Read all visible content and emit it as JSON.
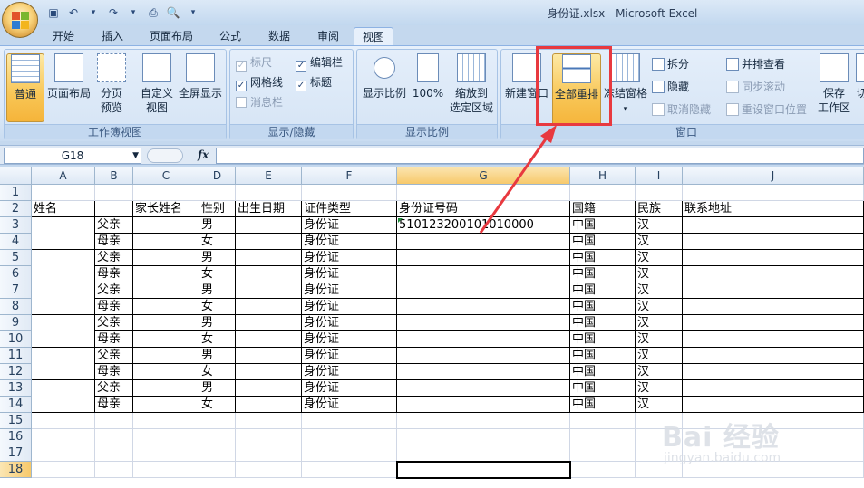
{
  "window": {
    "title": "身份证.xlsx - Microsoft Excel"
  },
  "tabs": [
    "开始",
    "插入",
    "页面布局",
    "公式",
    "数据",
    "审阅",
    "视图"
  ],
  "active_tab": "视图",
  "ribbon": {
    "workbook_views": {
      "label": "工作簿视图",
      "normal": "普通",
      "page_layout": "页面布局",
      "page_break_1": "分页",
      "page_break_2": "预览",
      "custom_1": "自定义",
      "custom_2": "视图",
      "fullscreen": "全屏显示"
    },
    "show_hide": {
      "label": "显示/隐藏",
      "ruler": "标尺",
      "gridlines": "网格线",
      "messagebar": "消息栏",
      "formulabar": "编辑栏",
      "headings": "标题"
    },
    "zoom": {
      "label": "显示比例",
      "zoom": "显示比例",
      "hundred": "100%",
      "selection_1": "缩放到",
      "selection_2": "选定区域"
    },
    "window": {
      "label": "窗口",
      "new_window": "新建窗口",
      "arrange_all": "全部重排",
      "freeze": "冻结窗格",
      "split": "拆分",
      "hide": "隐藏",
      "unhide": "取消隐藏",
      "side_by_side": "并排查看",
      "sync_scroll": "同步滚动",
      "reset_pos": "重设窗口位置",
      "save_ws_1": "保存",
      "save_ws_2": "工作区",
      "switch": "切"
    }
  },
  "formula_bar": {
    "name_box": "G18",
    "fx": "fx",
    "content": ""
  },
  "columns": [
    "A",
    "B",
    "C",
    "D",
    "E",
    "F",
    "G",
    "H",
    "I",
    "J"
  ],
  "rows": [
    "1",
    "2",
    "3",
    "4",
    "5",
    "6",
    "7",
    "8",
    "9",
    "10",
    "11",
    "12",
    "13",
    "14",
    "15",
    "16",
    "17",
    "18"
  ],
  "headers_row2": {
    "A": "姓名",
    "C": "家长姓名",
    "D": "性别",
    "E": "出生日期",
    "F": "证件类型",
    "G": "身份证号码",
    "H": "国籍",
    "I": "民族",
    "J": "联系地址"
  },
  "data_rows": [
    {
      "B": "父亲",
      "D": "男",
      "F": "身份证",
      "G": "510123200101010000",
      "H": "中国",
      "I": "汉"
    },
    {
      "B": "母亲",
      "D": "女",
      "F": "身份证",
      "G": "",
      "H": "中国",
      "I": "汉"
    },
    {
      "B": "父亲",
      "D": "男",
      "F": "身份证",
      "G": "",
      "H": "中国",
      "I": "汉"
    },
    {
      "B": "母亲",
      "D": "女",
      "F": "身份证",
      "G": "",
      "H": "中国",
      "I": "汉"
    },
    {
      "B": "父亲",
      "D": "男",
      "F": "身份证",
      "G": "",
      "H": "中国",
      "I": "汉"
    },
    {
      "B": "母亲",
      "D": "女",
      "F": "身份证",
      "G": "",
      "H": "中国",
      "I": "汉"
    },
    {
      "B": "父亲",
      "D": "男",
      "F": "身份证",
      "G": "",
      "H": "中国",
      "I": "汉"
    },
    {
      "B": "母亲",
      "D": "女",
      "F": "身份证",
      "G": "",
      "H": "中国",
      "I": "汉"
    },
    {
      "B": "父亲",
      "D": "男",
      "F": "身份证",
      "G": "",
      "H": "中国",
      "I": "汉"
    },
    {
      "B": "母亲",
      "D": "女",
      "F": "身份证",
      "G": "",
      "H": "中国",
      "I": "汉"
    },
    {
      "B": "父亲",
      "D": "男",
      "F": "身份证",
      "G": "",
      "H": "中国",
      "I": "汉"
    },
    {
      "B": "母亲",
      "D": "女",
      "F": "身份证",
      "G": "",
      "H": "中国",
      "I": "汉"
    }
  ],
  "watermark": {
    "brand": "Bai 经验",
    "url": "jingyan.baidu.com"
  },
  "colors": {
    "highlight": "#e8393f",
    "accent": "#f7c96b"
  }
}
